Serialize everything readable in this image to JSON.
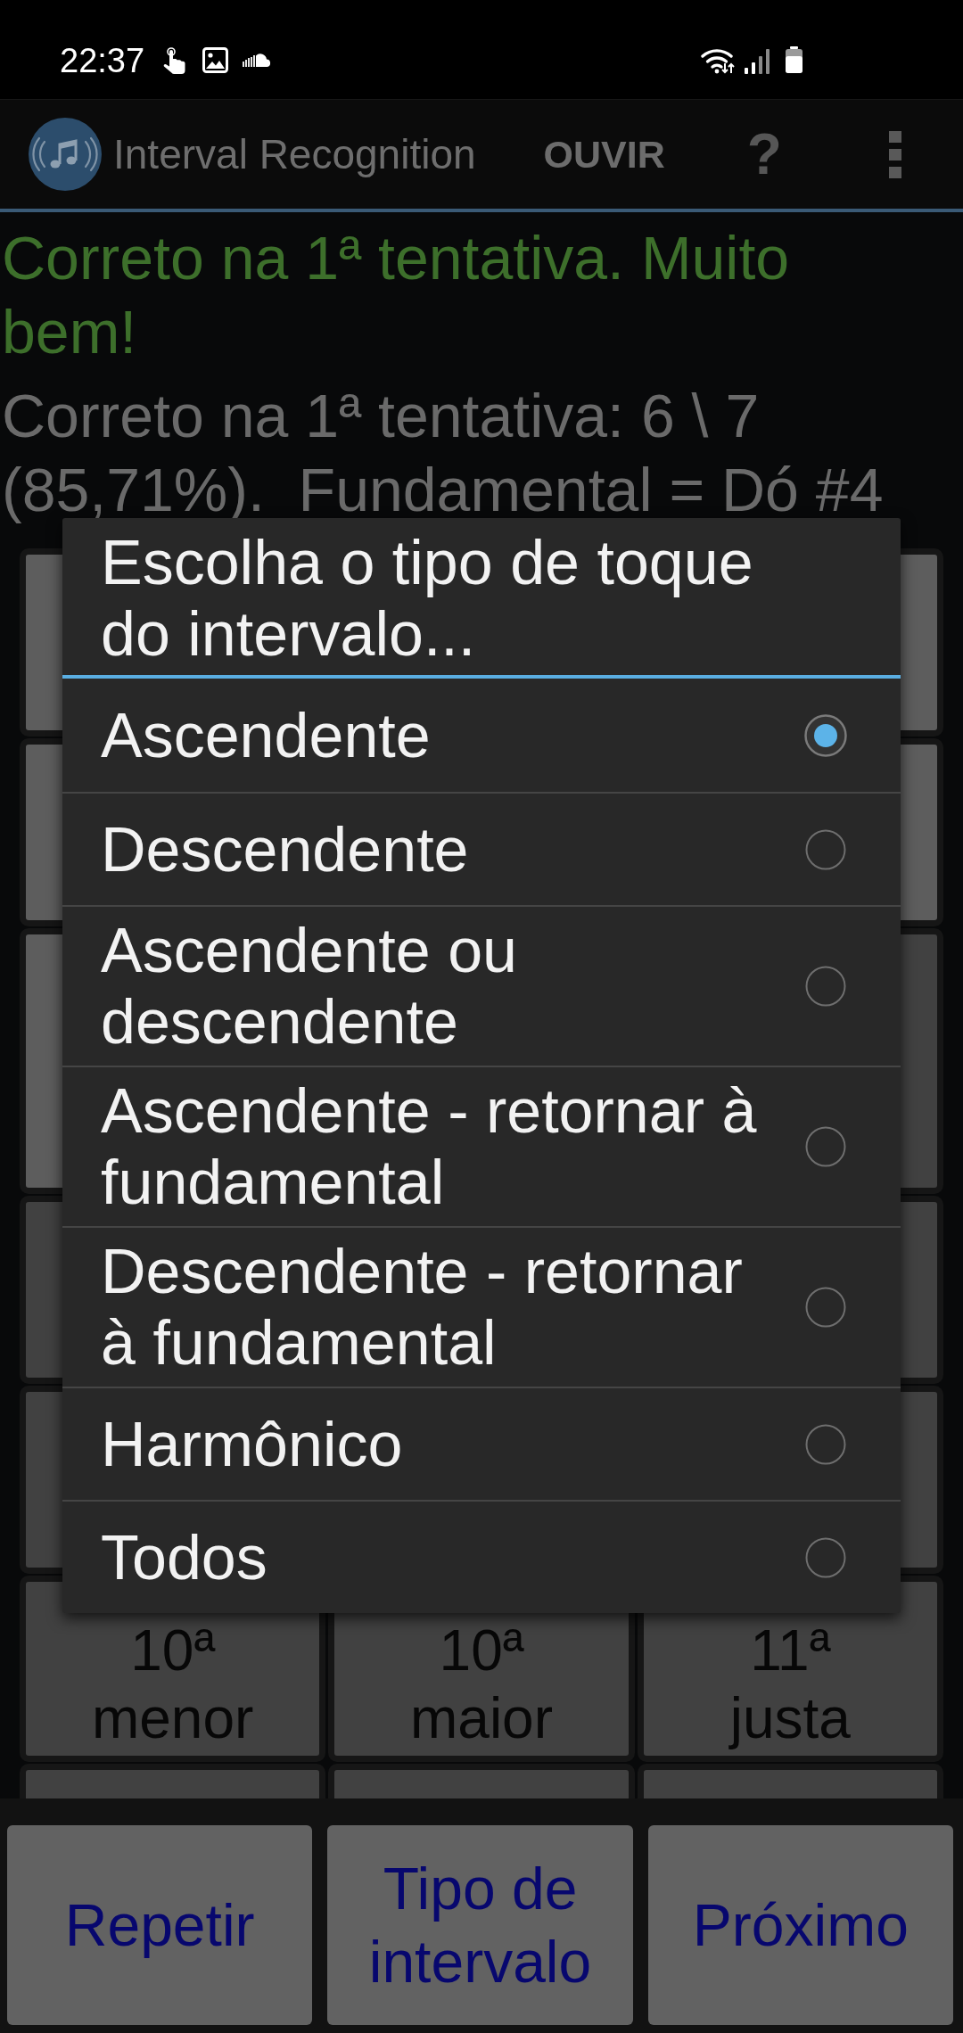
{
  "status_bar": {
    "time": "22:37"
  },
  "app_bar": {
    "title": "Interval Recognition",
    "listen_button": "OUVIR",
    "help_button": "?"
  },
  "feedback": {
    "result": "Correto na 1ª tentativa. Muito bem!",
    "score": "Correto na 1ª tentativa: 6 \\ 7 (85,71%).  Fundamental = Dó #4"
  },
  "interval_grid": {
    "rows": [
      {
        "cells": [
          {
            "enabled": true
          },
          {
            "enabled": true
          }
        ]
      },
      {
        "cells": [
          {
            "enabled": true
          },
          {
            "enabled": true
          }
        ]
      },
      {
        "cells": [
          {
            "enabled": true
          },
          {
            "enabled": false
          }
        ]
      },
      {
        "cells": [
          {
            "enabled": false
          },
          {
            "enabled": false
          }
        ]
      },
      {
        "cells": [
          {
            "enabled": false
          },
          {
            "enabled": false
          }
        ]
      },
      {
        "cells": [
          {
            "label": "10ª menor",
            "enabled": false
          },
          {
            "label": "10ª maior",
            "enabled": false
          },
          {
            "label": "11ª justa",
            "enabled": false
          }
        ]
      },
      {
        "cells": [
          {
            "enabled": false
          },
          {
            "enabled": false
          },
          {
            "enabled": false
          }
        ]
      }
    ]
  },
  "touch_type_dialog": {
    "title": "Escolha o tipo de toque do intervalo...",
    "options": [
      {
        "label": "Ascendente",
        "selected": true
      },
      {
        "label": "Descendente",
        "selected": false
      },
      {
        "label": "Ascendente ou descendente",
        "selected": false
      },
      {
        "label": "Ascendente - retornar à fundamental",
        "selected": false
      },
      {
        "label": "Descendente - retornar à fundamental",
        "selected": false
      },
      {
        "label": "Harmônico",
        "selected": false
      },
      {
        "label": "Todos",
        "selected": false
      }
    ]
  },
  "bottom_buttons": [
    "Repetir",
    "Tipo de intervalo",
    "Próximo"
  ]
}
